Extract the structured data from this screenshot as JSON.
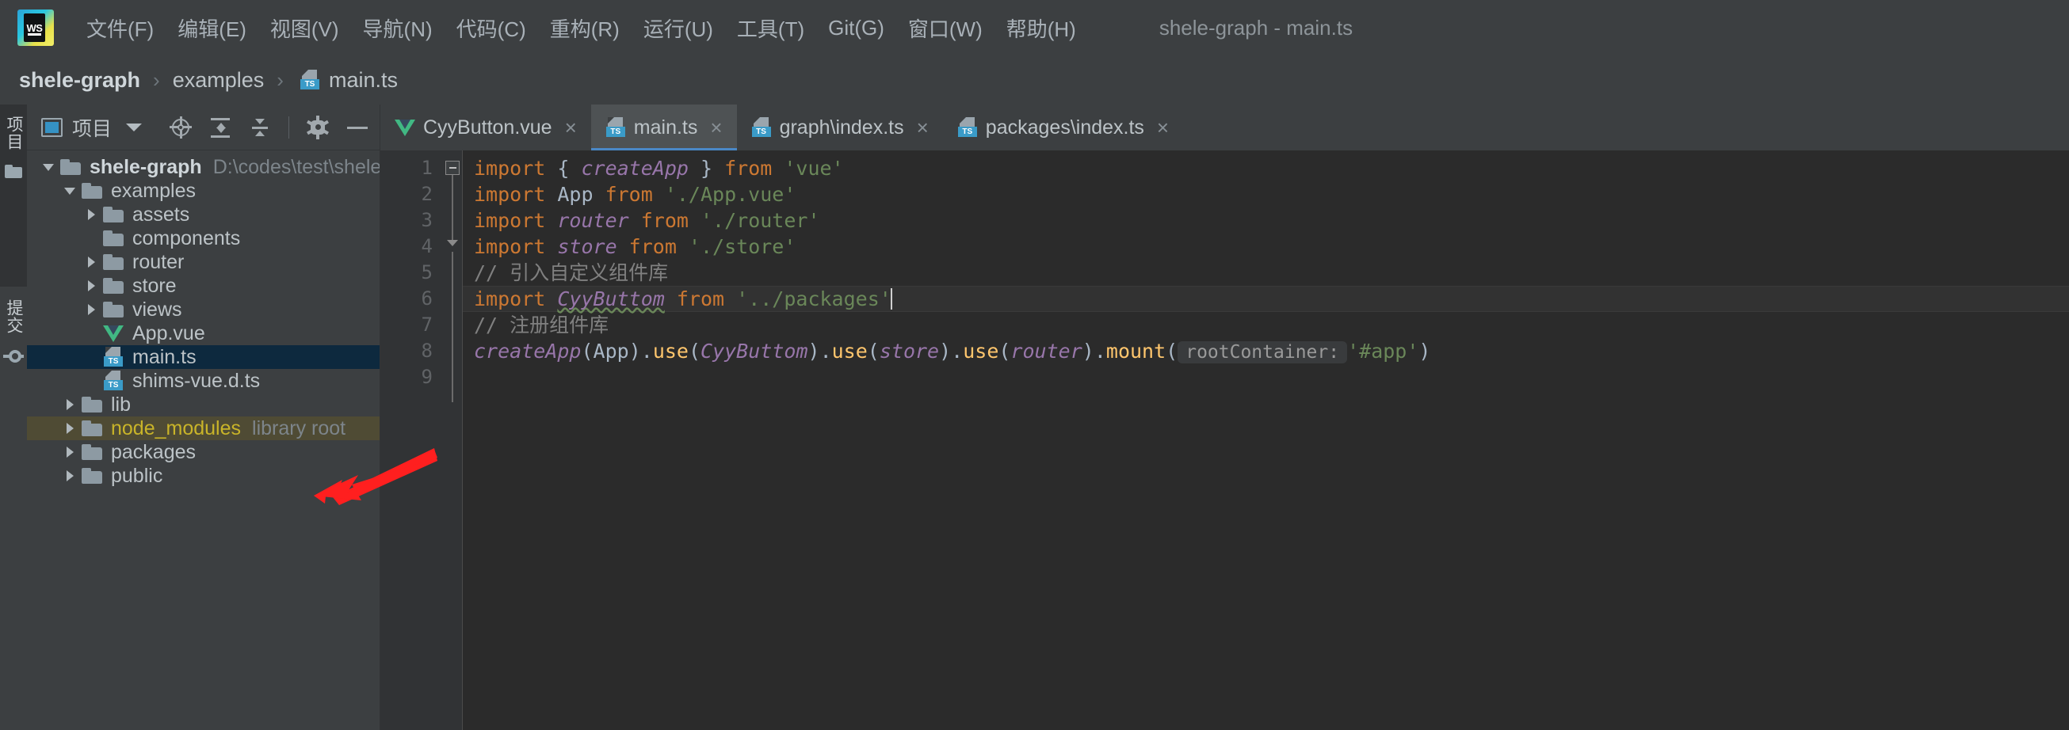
{
  "window": {
    "title": "shele-graph - main.ts",
    "logo_text": "WS"
  },
  "menu": {
    "items": [
      {
        "label": "文件(F)",
        "text": "文件(",
        "mnemonic": "F",
        "tail": ")"
      },
      {
        "label": "编辑(E)",
        "text": "编辑(",
        "mnemonic": "E",
        "tail": ")"
      },
      {
        "label": "视图(V)",
        "text": "视图(",
        "mnemonic": "V",
        "tail": ")"
      },
      {
        "label": "导航(N)",
        "text": "导航(",
        "mnemonic": "N",
        "tail": ")"
      },
      {
        "label": "代码(C)",
        "text": "代码(",
        "mnemonic": "C",
        "tail": ")"
      },
      {
        "label": "重构(R)",
        "text": "重构(",
        "mnemonic": "R",
        "tail": ")"
      },
      {
        "label": "运行(U)",
        "text": "运行(",
        "mnemonic": "U",
        "tail": ")"
      },
      {
        "label": "工具(T)",
        "text": "工具(",
        "mnemonic": "T",
        "tail": ")"
      },
      {
        "label": "Git(G)",
        "text": "Git(",
        "mnemonic": "G",
        "tail": ")"
      },
      {
        "label": "窗口(W)",
        "text": "窗口(",
        "mnemonic": "W",
        "tail": ")"
      },
      {
        "label": "帮助(H)",
        "text": "帮助(",
        "mnemonic": "H",
        "tail": ")"
      }
    ]
  },
  "breadcrumb": {
    "project": "shele-graph",
    "folder": "examples",
    "file": "main.ts",
    "separator": "›"
  },
  "rail": {
    "project_label": "项目",
    "commit_label": "提交"
  },
  "project_panel": {
    "title": "项目",
    "tools": [
      "locate-target",
      "expand-all",
      "collapse-all",
      "settings-gear",
      "hide-minus"
    ],
    "tree": [
      {
        "label": "shele-graph",
        "hint": "D:\\codes\\test\\shele-graph",
        "icon": "folder",
        "twisty": "down",
        "indent": 0,
        "bold": true,
        "state": "normal"
      },
      {
        "label": "examples",
        "hint": "",
        "icon": "folder",
        "twisty": "down",
        "indent": 1,
        "bold": false,
        "state": "normal"
      },
      {
        "label": "assets",
        "hint": "",
        "icon": "folder",
        "twisty": "right",
        "indent": 2,
        "bold": false,
        "state": "normal"
      },
      {
        "label": "components",
        "hint": "",
        "icon": "folder",
        "twisty": "none",
        "indent": 2,
        "bold": false,
        "state": "normal"
      },
      {
        "label": "router",
        "hint": "",
        "icon": "folder",
        "twisty": "right",
        "indent": 2,
        "bold": false,
        "state": "normal"
      },
      {
        "label": "store",
        "hint": "",
        "icon": "folder",
        "twisty": "right",
        "indent": 2,
        "bold": false,
        "state": "normal"
      },
      {
        "label": "views",
        "hint": "",
        "icon": "folder",
        "twisty": "right",
        "indent": 2,
        "bold": false,
        "state": "normal"
      },
      {
        "label": "App.vue",
        "hint": "",
        "icon": "vue",
        "twisty": "none",
        "indent": 2,
        "bold": false,
        "state": "normal"
      },
      {
        "label": "main.ts",
        "hint": "",
        "icon": "ts",
        "twisty": "none",
        "indent": 2,
        "bold": false,
        "state": "selected"
      },
      {
        "label": "shims-vue.d.ts",
        "hint": "",
        "icon": "ts",
        "twisty": "none",
        "indent": 2,
        "bold": false,
        "state": "normal"
      },
      {
        "label": "lib",
        "hint": "",
        "icon": "folder",
        "twisty": "right",
        "indent": 1,
        "bold": false,
        "state": "normal"
      },
      {
        "label": "node_modules",
        "hint": "library root",
        "icon": "folder",
        "twisty": "right",
        "indent": 1,
        "bold": false,
        "state": "library"
      },
      {
        "label": "packages",
        "hint": "",
        "icon": "folder",
        "twisty": "right",
        "indent": 1,
        "bold": false,
        "state": "normal"
      },
      {
        "label": "public",
        "hint": "",
        "icon": "folder",
        "twisty": "right",
        "indent": 1,
        "bold": false,
        "state": "normal"
      }
    ]
  },
  "editor": {
    "tabs": [
      {
        "label": "CyyButton.vue",
        "icon": "vue",
        "active": false,
        "close": "×"
      },
      {
        "label": "main.ts",
        "icon": "ts",
        "active": true,
        "close": "×"
      },
      {
        "label": "graph\\index.ts",
        "icon": "ts",
        "active": false,
        "close": "×"
      },
      {
        "label": "packages\\index.ts",
        "icon": "ts",
        "active": false,
        "close": "×"
      }
    ],
    "line_numbers": [
      "1",
      "2",
      "3",
      "4",
      "5",
      "6",
      "7",
      "8",
      "9"
    ],
    "current_line": 6,
    "inlay_hint": "rootContainer:",
    "lines": [
      {
        "n": 1,
        "tokens": [
          {
            "t": "import ",
            "c": "kw"
          },
          {
            "t": "{ ",
            "c": "brc"
          },
          {
            "t": "createApp",
            "c": "var"
          },
          {
            "t": " }",
            "c": "brc"
          },
          {
            "t": " from ",
            "c": "kw"
          },
          {
            "t": "'vue'",
            "c": "str"
          }
        ]
      },
      {
        "n": 2,
        "tokens": [
          {
            "t": "import ",
            "c": "kw"
          },
          {
            "t": "App",
            "c": "id"
          },
          {
            "t": " from ",
            "c": "kw"
          },
          {
            "t": "'./App.vue'",
            "c": "str"
          }
        ]
      },
      {
        "n": 3,
        "tokens": [
          {
            "t": "import ",
            "c": "kw"
          },
          {
            "t": "router",
            "c": "var"
          },
          {
            "t": " from ",
            "c": "kw"
          },
          {
            "t": "'./router'",
            "c": "str"
          }
        ]
      },
      {
        "n": 4,
        "tokens": [
          {
            "t": "import ",
            "c": "kw"
          },
          {
            "t": "store",
            "c": "var"
          },
          {
            "t": " from ",
            "c": "kw"
          },
          {
            "t": "'./store'",
            "c": "str"
          }
        ]
      },
      {
        "n": 5,
        "tokens": [
          {
            "t": "// 引入自定义组件库",
            "c": "cmt"
          }
        ]
      },
      {
        "n": 6,
        "tokens": [
          {
            "t": "import ",
            "c": "kw"
          },
          {
            "t": "CyyButtom",
            "c": "err"
          },
          {
            "t": " from ",
            "c": "kw"
          },
          {
            "t": "'../packages'",
            "c": "str"
          }
        ]
      },
      {
        "n": 7,
        "tokens": [
          {
            "t": "// 注册组件库",
            "c": "cmt"
          }
        ]
      },
      {
        "n": 8,
        "tokens": [
          {
            "t": "createApp",
            "c": "var"
          },
          {
            "t": "(",
            "c": "brc"
          },
          {
            "t": "App",
            "c": "id"
          },
          {
            "t": ")",
            "c": "brc"
          },
          {
            "t": ".",
            "c": "brc"
          },
          {
            "t": "use",
            "c": "fn"
          },
          {
            "t": "(",
            "c": "brc"
          },
          {
            "t": "CyyButtom",
            "c": "var"
          },
          {
            "t": ")",
            "c": "brc"
          },
          {
            "t": ".",
            "c": "brc"
          },
          {
            "t": "use",
            "c": "fn"
          },
          {
            "t": "(",
            "c": "brc"
          },
          {
            "t": "store",
            "c": "var"
          },
          {
            "t": ")",
            "c": "brc"
          },
          {
            "t": ".",
            "c": "brc"
          },
          {
            "t": "use",
            "c": "fn"
          },
          {
            "t": "(",
            "c": "brc"
          },
          {
            "t": "router",
            "c": "var"
          },
          {
            "t": ")",
            "c": "brc"
          },
          {
            "t": ".",
            "c": "brc"
          },
          {
            "t": "mount",
            "c": "fn"
          },
          {
            "t": "(",
            "c": "brc"
          },
          {
            "t": "rootContainer:",
            "c": "hint"
          },
          {
            "t": "'#app'",
            "c": "str"
          },
          {
            "t": ")",
            "c": "brc"
          }
        ]
      },
      {
        "n": 9,
        "tokens": []
      }
    ]
  },
  "annotation": {
    "arrow_color": "#ff2020",
    "points_to": "main.ts"
  },
  "colors": {
    "accent": "#3592c4",
    "selection": "#0d293e",
    "library_root": "#4f4b34",
    "library_text": "#c9b429",
    "editor_bg": "#2b2b2b",
    "panel_bg": "#3c3f41"
  }
}
